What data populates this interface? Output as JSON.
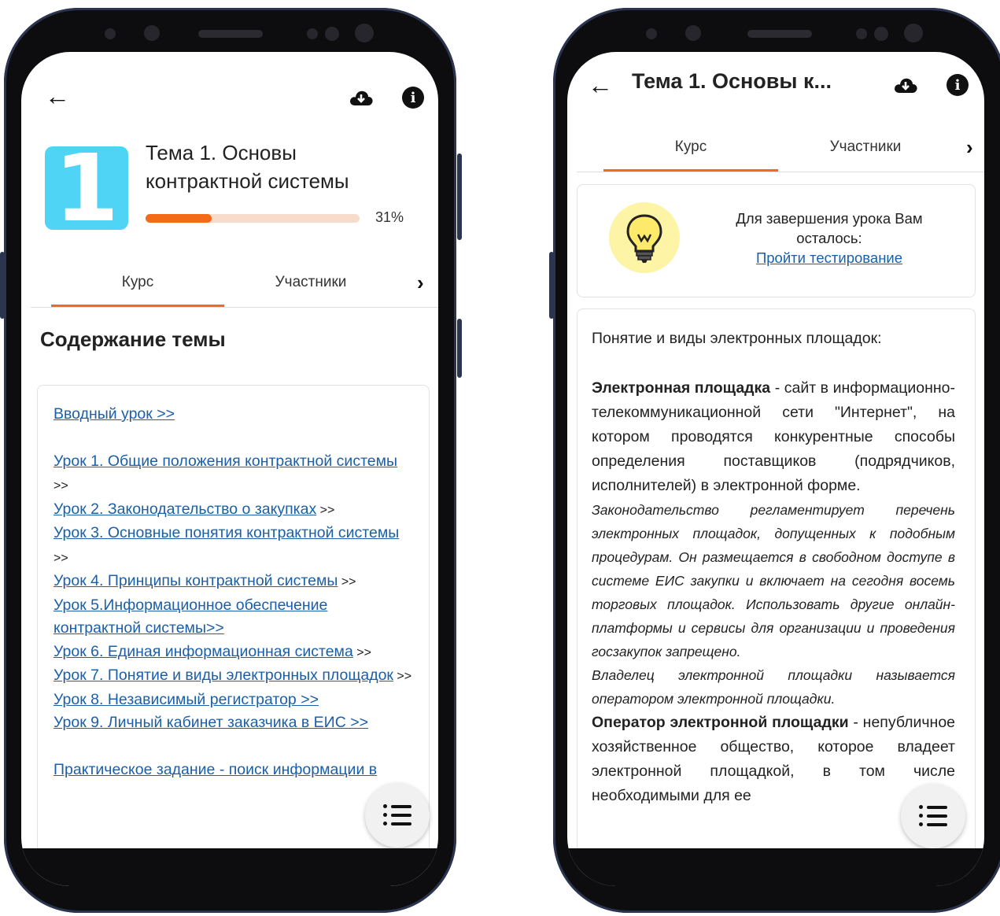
{
  "left": {
    "course": {
      "title": "Тема 1. Основы контрактной системы",
      "progress_percent": 31,
      "progress_text": "31%",
      "logo_digit": "1"
    },
    "tabs": [
      {
        "label": "Курс",
        "active": true
      },
      {
        "label": "Участники",
        "active": false
      }
    ],
    "section_title": "Содержание темы",
    "lessons": [
      {
        "text": "Вводный урок  >>",
        "tail": ""
      },
      {
        "text": "Урок 1. Общие положения контрактной системы",
        "tail": " >>"
      },
      {
        "text": "Урок 2. Законодательство о закупках",
        "tail": " >>"
      },
      {
        "text": "Урок 3. Основные понятия контрактной системы",
        "tail": " >>"
      },
      {
        "text": "Урок 4. Принципы контрактной системы",
        "tail": " >>"
      },
      {
        "text": "Урок 5.Информационное обеспечение контрактной системы>>",
        "tail": ""
      },
      {
        "text": "Урок 6. Единая информационная система",
        "tail": " >>"
      },
      {
        "text": "Урок 7. Понятие и виды электронных площадок",
        "tail": " >>"
      },
      {
        "text": "Урок 8. Независимый регистратор >>",
        "tail": ""
      },
      {
        "text": "Урок 9. Личный кабинет заказчика в ЕИС >>",
        "tail": ""
      },
      {
        "text": "Практическое задание - поиск информации в",
        "tail": ""
      }
    ]
  },
  "right": {
    "title": "Тема 1. Основы к...",
    "tabs": [
      {
        "label": "Курс",
        "active": true
      },
      {
        "label": "Участники",
        "active": false
      }
    ],
    "hint": {
      "text": "Для завершения урока Вам осталось:",
      "link": "Пройти тестирование"
    },
    "content": {
      "heading": "Понятие и виды электронных площадок:",
      "p1_bold": "Электронная площадка",
      "p1_rest": " - сайт в информационно-телекоммуникационной сети \"Интернет\", на котором проводятся конкурентные способы определения поставщиков (подрядчиков, исполнителей) в электронной форме.",
      "p2": "Законодательство регламентирует перечень электронных площадок, допущенных к подобным процедурам. Он размещается в свободном доступе в системе ЕИС закупки и включает на сегодня восемь торговых площадок. Использовать другие онлайн-платформы и сервисы для организации и проведения госзакупок запрещено.",
      "p3": "Владелец электронной площадки называется оператором электронной площадки.",
      "p4_bold": "Оператор электронной площадки",
      "p4_rest": " - непубличное хозяйственное общество, которое владеет электронной площадкой, в том числе необходимыми для ее"
    }
  },
  "colors": {
    "accent": "#f36b16",
    "progress_track": "#f7dccb",
    "link": "#1a5fa8",
    "logo_bg": "#4fd4f5",
    "bulb_bg": "#fdf4a6"
  },
  "icons": {
    "back": "arrow-left-icon",
    "download": "cloud-download-icon",
    "info": "info-icon",
    "chevron": "chevron-right-icon",
    "menu": "list-icon",
    "bulb": "lightbulb-icon"
  }
}
